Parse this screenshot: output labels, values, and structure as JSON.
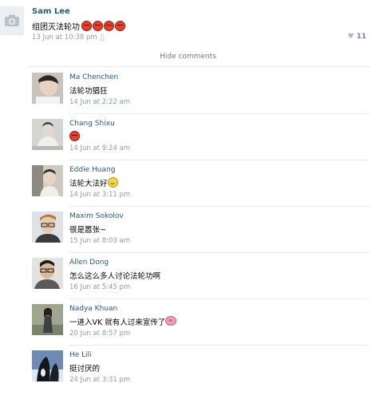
{
  "post": {
    "author": "Sam Lee",
    "text": "组团灭法轮功",
    "emoji_icons": [
      "angry-face-icon",
      "angry-face-icon",
      "angry-face-icon",
      "angry-face-icon"
    ],
    "timestamp": "13 Jun at 10:38 pm",
    "platform_icon": "apple-icon",
    "likes": "11"
  },
  "hide_comments_label": "Hide comments",
  "comments": [
    {
      "author": "Ma Chenchen",
      "text": "法轮功猖狂",
      "time": "14 Jun at 2:22 am"
    },
    {
      "author": "Chang Shixu",
      "text": "",
      "emoji": "angry-face-icon",
      "time": "14 Jun at 9:24 am"
    },
    {
      "author": "Eddie Huang",
      "text": "法轮大法好",
      "emoji": "smile-face-icon",
      "time": "14 Jun at 3:11 pm"
    },
    {
      "author": "Maxim Sokolov",
      "text": "很是嚣张~",
      "time": "15 Jun at 8:03 am"
    },
    {
      "author": "Allen Dong",
      "text": "怎么这么多人讨论法轮功啊",
      "time": "16 Jun at 5:45 pm"
    },
    {
      "author": "Nadya Khuan",
      "text": "一进入VK 就有人过来宣传了",
      "emoji": "pig-face-icon",
      "time": "20 Jun at 8:57 pm"
    },
    {
      "author": "He Lili",
      "text": "挺讨厌的",
      "time": "24 Jun at 3:31 pm"
    }
  ],
  "colors": {
    "link": "#2b587a",
    "meta": "#8e9aa6",
    "divider": "#e7eaee"
  }
}
